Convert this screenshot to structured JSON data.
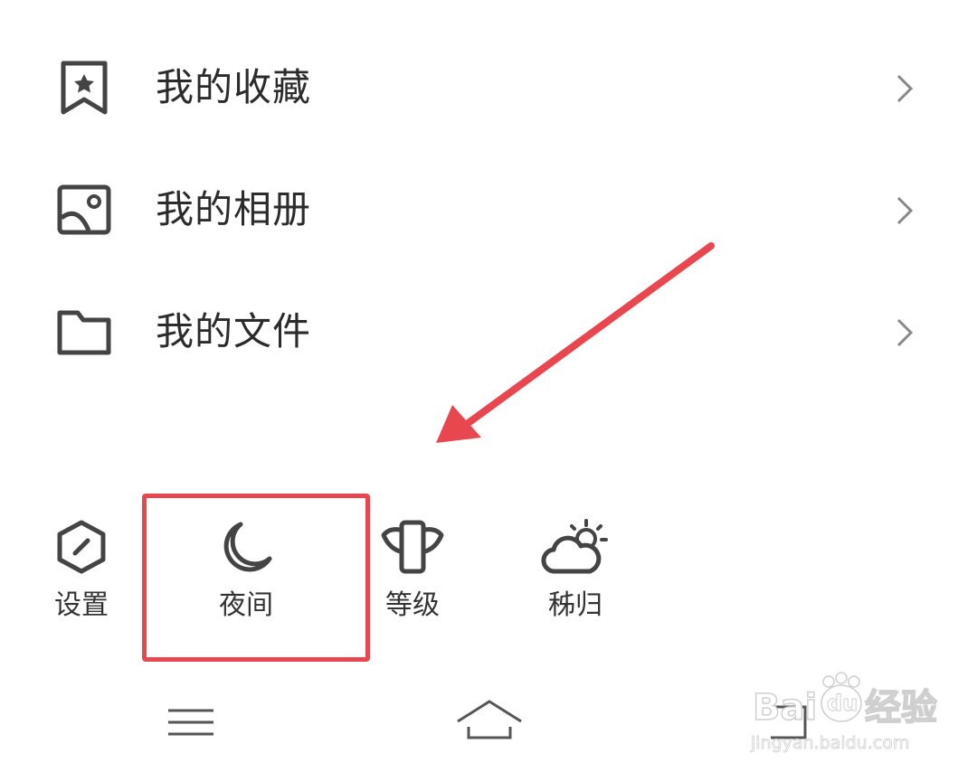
{
  "menu": [
    {
      "id": "favorites",
      "label": "我的收藏",
      "icon": "bookmark-star-icon"
    },
    {
      "id": "album",
      "label": "我的相册",
      "icon": "photo-album-icon"
    },
    {
      "id": "files",
      "label": "我的文件",
      "icon": "folder-icon"
    }
  ],
  "toolbar": [
    {
      "id": "settings",
      "label": "设置",
      "icon": "hexagon-settings-icon"
    },
    {
      "id": "night",
      "label": "夜间",
      "icon": "moon-icon"
    },
    {
      "id": "level",
      "label": "等级",
      "icon": "winged-phone-icon"
    },
    {
      "id": "weather",
      "label": "秭归",
      "icon": "cloud-sun-icon"
    }
  ],
  "annotation": {
    "highlight_color": "#e8474f",
    "arrow_color": "#e8474f"
  },
  "navbar": {
    "menu_icon": "hamburger-icon",
    "home_icon": "home-icon",
    "back_icon": "back-icon"
  },
  "watermark": {
    "brand": "Bai",
    "brand2": "du",
    "suffix": "经验",
    "url": "jingyan.baidu.com"
  }
}
